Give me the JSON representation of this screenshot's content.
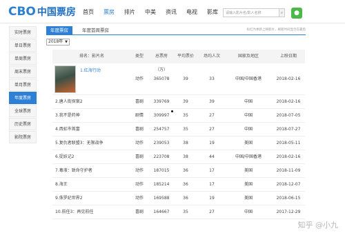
{
  "logo": {
    "text": "CBO",
    "cn": "中国票房"
  },
  "nav": [
    "首页",
    "票房",
    "排片",
    "中美",
    "资讯",
    "电视",
    "影库"
  ],
  "search": {
    "placeholder": "请输入影片名/影人名称"
  },
  "sidebar": [
    "实时票房",
    "单日票房",
    "单周票房",
    "周末票房",
    "单月票房",
    "年度票房",
    "全球票房",
    "历史票房",
    "影院票房"
  ],
  "tabs": {
    "active": "年度票房",
    "second": "年度首周票房",
    "hint": "标红为季新上映影片，刷新时间显示在最后"
  },
  "year_select": "2018年",
  "table": {
    "headers": [
      "排名：影片名",
      "类型",
      "总票房（万）",
      "平均票价",
      "场均人次",
      "国家及地区",
      "上映日期"
    ],
    "rows": [
      {
        "name": "1.红海行动",
        "type": "动作",
        "box": "365078",
        "price": "39",
        "per": "33",
        "region": "中国/中国香港",
        "date": "2018-02-16"
      },
      {
        "name": "2.唐人街探案2",
        "type": "喜剧",
        "box": "339769",
        "price": "39",
        "per": "39",
        "region": "中国",
        "date": "2018-02-16"
      },
      {
        "name": "3.我不是药神",
        "type": "剧情",
        "box": "309997",
        "price": "35",
        "per": "27",
        "region": "中国",
        "date": "2018-07-05"
      },
      {
        "name": "4.西虹市首富",
        "type": "喜剧",
        "box": "254757",
        "price": "35",
        "per": "27",
        "region": "中国",
        "date": "2018-07-27"
      },
      {
        "name": "5.复仇者联盟3：无限战争",
        "type": "动作",
        "box": "239053",
        "price": "38",
        "per": "19",
        "region": "美国",
        "date": "2018-05-11"
      },
      {
        "name": "6.捉妖记2",
        "type": "喜剧",
        "box": "223708",
        "price": "38",
        "per": "44",
        "region": "中国/中国香港",
        "date": "2018-02-16"
      },
      {
        "name": "7.毒液：致命守护者",
        "type": "动作",
        "box": "187015",
        "price": "36",
        "per": "17",
        "region": "美国",
        "date": "2018-11-09"
      },
      {
        "name": "8.海王",
        "type": "动作",
        "box": "185214",
        "price": "36",
        "per": "17",
        "region": "美国",
        "date": "2018-12-07"
      },
      {
        "name": "9.侏罗纪世界2",
        "type": "动作",
        "box": "169588",
        "price": "36",
        "per": "19",
        "region": "美国",
        "date": "2018-06-15"
      },
      {
        "name": "10.前任3：再见前任",
        "type": "喜剧",
        "box": "164667",
        "price": "35",
        "per": "27",
        "region": "中国",
        "date": "2017-12-29"
      }
    ]
  },
  "watermark": "知乎 @小九"
}
